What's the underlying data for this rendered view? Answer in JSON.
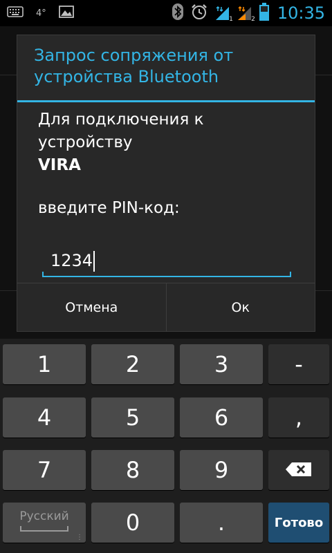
{
  "status_bar": {
    "temperature": "4°",
    "time": "10:35",
    "sim1_label": "1",
    "sim2_label": "2",
    "accent_color": "#33b5e5"
  },
  "dialog": {
    "title": "Запрос сопряжения от устройства Bluetooth",
    "message_line": "Для подключения к устройству",
    "device_name": "VIRA",
    "prompt": "введите PIN-код:",
    "pin_value": "1234",
    "cancel_label": "Отмена",
    "ok_label": "Ок"
  },
  "keyboard": {
    "keys": [
      "1",
      "2",
      "3",
      "-",
      "4",
      "5",
      "6",
      ",",
      "7",
      "8",
      "9"
    ],
    "language_label": "Русский",
    "zero": "0",
    "dot": ".",
    "done_label": "Готово"
  }
}
